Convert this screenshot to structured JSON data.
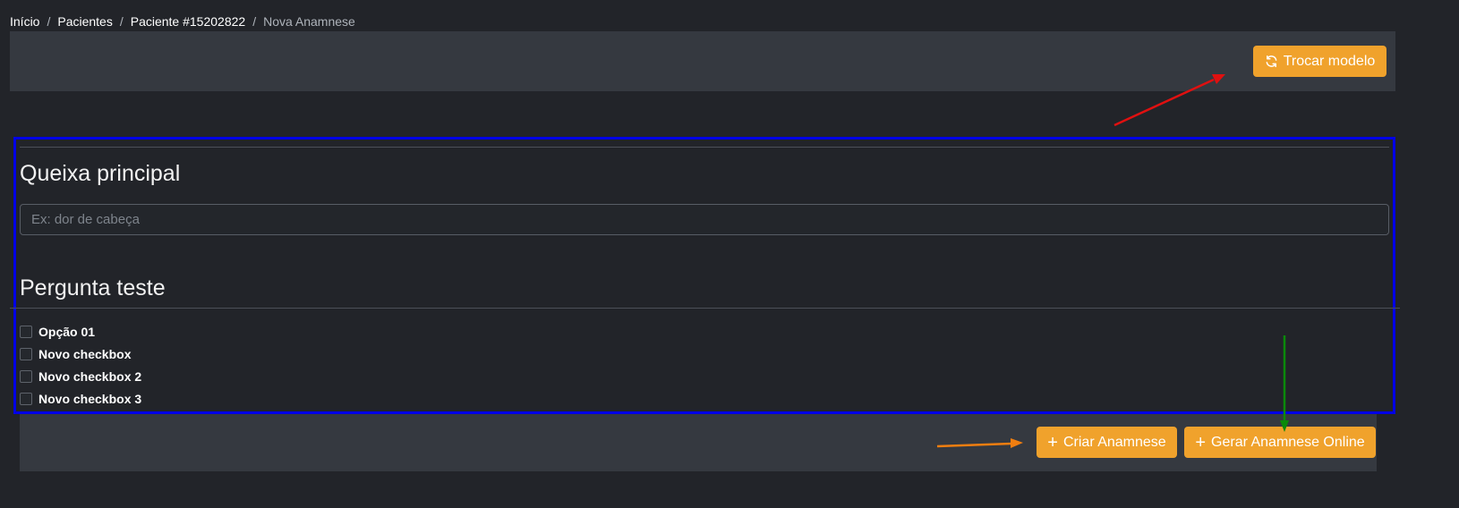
{
  "breadcrumb": {
    "items": [
      "Início",
      "Pacientes",
      "Paciente #15202822"
    ],
    "current": "Nova Anamnese",
    "separator": "/"
  },
  "header": {
    "swap_button_label": "Trocar modelo",
    "swap_icon": "refresh-icon"
  },
  "form": {
    "question_1": {
      "title": "Queixa principal",
      "placeholder": "Ex: dor de cabeça",
      "value": ""
    },
    "question_2": {
      "title": "Pergunta teste",
      "options": [
        "Opção 01",
        "Novo checkbox",
        "Novo checkbox 2",
        "Novo checkbox 3"
      ]
    }
  },
  "footer": {
    "create_button_label": "Criar Anamnese",
    "online_button_label": "Gerar Anamnese Online",
    "plus_glyph": "+"
  },
  "colors": {
    "background": "#222429",
    "panel": "#353940",
    "accent": "#f0a22c",
    "highlight_box": "#0000e6",
    "arrow_red": "#e01010",
    "arrow_orange": "#f07e10",
    "arrow_green": "#0a8a0a"
  }
}
